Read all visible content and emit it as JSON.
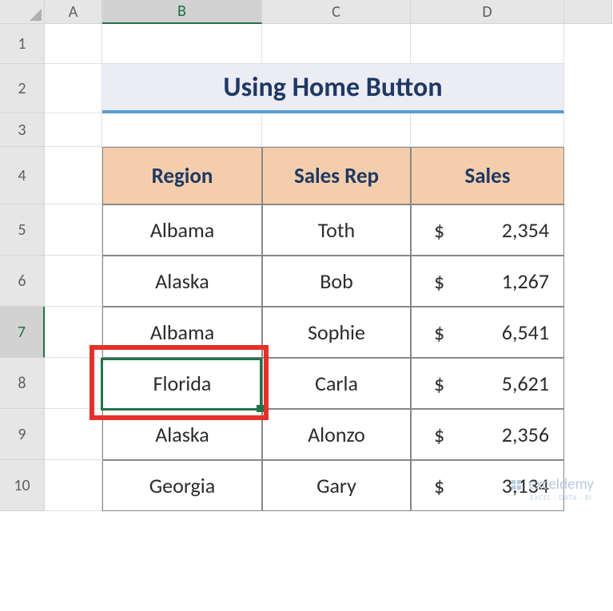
{
  "columns": [
    "A",
    "B",
    "C",
    "D"
  ],
  "rows": [
    "1",
    "2",
    "3",
    "4",
    "5",
    "6",
    "7",
    "8",
    "9",
    "10"
  ],
  "activeCol": "B",
  "activeRow": "7",
  "title": "Using Home Button",
  "table": {
    "headers": {
      "region": "Region",
      "rep": "Sales Rep",
      "sales": "Sales"
    },
    "rows": [
      {
        "region": "Albama",
        "rep": "Toth",
        "cur": "$",
        "val": "2,354"
      },
      {
        "region": "Alaska",
        "rep": "Bob",
        "cur": "$",
        "val": "1,267"
      },
      {
        "region": "Albama",
        "rep": "Sophie",
        "cur": "$",
        "val": "6,541"
      },
      {
        "region": "Florida",
        "rep": "Carla",
        "cur": "$",
        "val": "5,621"
      },
      {
        "region": "Alaska",
        "rep": "Alonzo",
        "cur": "$",
        "val": "2,356"
      },
      {
        "region": "Georgia",
        "rep": "Gary",
        "cur": "$",
        "val": "3,134"
      }
    ]
  },
  "watermark": {
    "brand": "exceldemy",
    "tag": "EXCEL · DATA · BI"
  }
}
